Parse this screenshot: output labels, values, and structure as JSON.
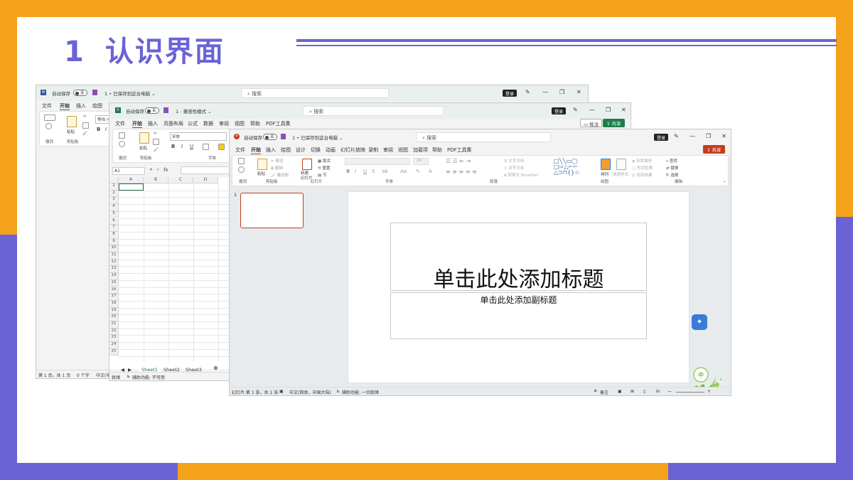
{
  "slide": {
    "number": "1",
    "title": "认识界面",
    "colors": {
      "accent_purple": "#6a63d6",
      "accent_orange": "#f5a21b"
    }
  },
  "word": {
    "autosave_label": "自动保存",
    "autosave_state": "关",
    "doc_title": "1 • 已保存到这台电脑 ⌄",
    "search_placeholder": "搜索",
    "login_label": "登录",
    "menu": [
      "文件",
      "开始",
      "插入",
      "绘图"
    ],
    "ribbon_groups": [
      "撤消",
      "剪贴板"
    ],
    "paste_label": "粘贴",
    "font_name": "等线 (中",
    "status": {
      "page": "第 1 页，共 1 页",
      "words": "0 个字",
      "lang": "中文(中"
    }
  },
  "excel": {
    "autosave_label": "自动保存",
    "autosave_state": "关",
    "doc_title": "1 - 兼容性模式 ⌄",
    "search_placeholder": "搜索",
    "login_label": "登录",
    "comment_label": "批注",
    "share_label": "共享",
    "menu": [
      "文件",
      "开始",
      "插入",
      "页面布局",
      "公式",
      "数据",
      "审阅",
      "视图",
      "帮助",
      "PDF工具集"
    ],
    "ribbon_groups": [
      "撤消",
      "剪贴板",
      "字体"
    ],
    "paste_label": "粘贴",
    "font_name": "宋体",
    "name_box": "A1",
    "fx_label": "fx",
    "columns": [
      "A",
      "B",
      "C",
      "D"
    ],
    "rows": [
      "1",
      "2",
      "3",
      "4",
      "5",
      "6",
      "7",
      "8",
      "9",
      "10",
      "11",
      "12",
      "13",
      "14",
      "15",
      "16",
      "17",
      "18",
      "19",
      "20",
      "21",
      "22",
      "23",
      "24",
      "25"
    ],
    "sheets": [
      "Sheet1",
      "Sheet2",
      "Sheet3"
    ],
    "add_sheet": "⊕",
    "status": {
      "ready": "就绪",
      "accessibility": "辅助功能: 不可用"
    }
  },
  "ppt": {
    "autosave_label": "自动保存",
    "autosave_state": "关",
    "doc_title": "1 • 已保存到这台电脑 ⌄",
    "search_placeholder": "搜索",
    "login_label": "登录",
    "share_label": "共享",
    "menu": [
      "文件",
      "开始",
      "插入",
      "绘图",
      "设计",
      "切换",
      "动画",
      "幻灯片放映",
      "录制",
      "审阅",
      "视图",
      "加载项",
      "帮助",
      "PDF工具集"
    ],
    "ribbon_groups": [
      "撤消",
      "剪贴板",
      "幻灯片",
      "字体",
      "段落",
      "绘图",
      "编辑"
    ],
    "paste_label": "粘贴",
    "new_slide_label": "新建\n幻灯片",
    "layout_label": "版式",
    "reset_label": "重置",
    "section_label": "节",
    "cut_label": "剪切",
    "copy_label": "复制",
    "format_painter_label": "格式刷",
    "text_direction_label": "文字方向",
    "align_text_label": "对齐文本",
    "smartart_label": "转换为 SmartArt",
    "arrange_label": "排列",
    "quick_styles_label": "快速样式",
    "shape_fill_label": "形状填充",
    "shape_outline_label": "形状轮廓",
    "shape_effects_label": "形状效果",
    "find_label": "查找",
    "replace_label": "替换",
    "select_label": "选择",
    "font_size": "24",
    "thumb_number": "1",
    "slide_title_placeholder": "单击此处添加标题",
    "slide_subtitle_placeholder": "单击此处添加副标题",
    "status": {
      "slide_count": "幻灯片 第 1 张，共 1 张",
      "lang": "中文(简体，中国大陆)",
      "accessibility": "辅助功能: 一切就绪",
      "notes": "备注"
    }
  }
}
